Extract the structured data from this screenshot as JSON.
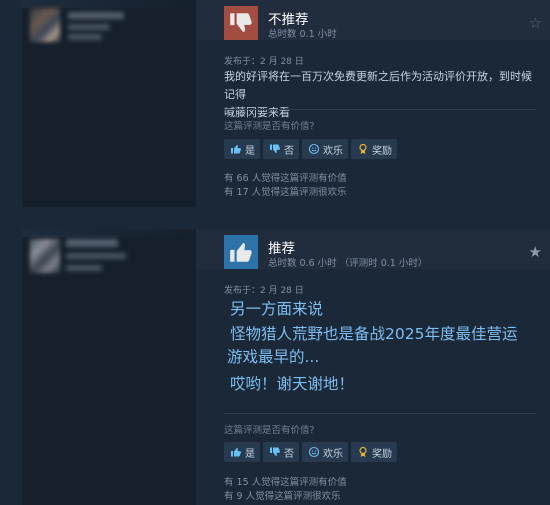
{
  "reviews": [
    {
      "verdict": "不推荐",
      "hours": "总时数 0.1 小时",
      "posted": "发布于：2 月 28 日",
      "body_lines": [
        "我的好评将在一百万次免费更新之后作为活动评价开放，到时候记得",
        "喊藤冈要来看"
      ],
      "helpful_question": "这篇评测是否有价值?",
      "buttons": {
        "yes": "是",
        "no": "否",
        "funny": "欢乐",
        "award": "奖励"
      },
      "stat_helpful": "有 66 人觉得这篇评测有价值",
      "stat_funny": "有 17 人觉得这篇评测很欢乐"
    },
    {
      "verdict": "推荐",
      "hours": "总时数 0.6 小时 （评测时 0.1 小时）",
      "posted": "发布于：2 月 28 日",
      "body_lines": [
        "另一方面来说",
        "怪物猎人荒野也是备战2025年度最佳营运",
        "游戏最早的...",
        "哎哟！谢天谢地！"
      ],
      "helpful_question": "这篇评测是否有价值?",
      "buttons": {
        "yes": "是",
        "no": "否",
        "funny": "欢乐",
        "award": "奖励"
      },
      "stat_helpful": "有 15 人觉得这篇评测有价值",
      "stat_funny": "有 9 人觉得这篇评测很欢乐"
    }
  ],
  "colors": {
    "negative": "#a34c42",
    "positive": "#2d73aa",
    "accent_text": "#7cbef0"
  },
  "icons": {
    "not_recommended": "thumbs-down-icon",
    "recommended": "thumbs-up-icon"
  }
}
